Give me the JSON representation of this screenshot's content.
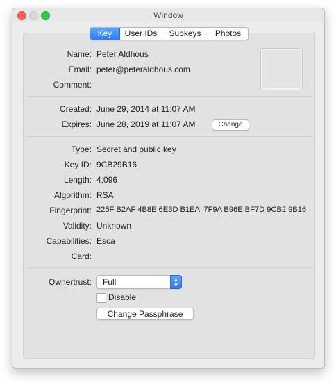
{
  "window": {
    "title": "Window"
  },
  "tabs": [
    {
      "label": "Key",
      "active": true
    },
    {
      "label": "User IDs",
      "active": false
    },
    {
      "label": "Subkeys",
      "active": false
    },
    {
      "label": "Photos",
      "active": false
    }
  ],
  "user": {
    "name_label": "Name:",
    "name": "Peter Aldhous",
    "email_label": "Email:",
    "email": "peter@peteraldhous.com",
    "comment_label": "Comment:",
    "comment": ""
  },
  "dates": {
    "created_label": "Created:",
    "created": "June 29, 2014 at 11:07 AM",
    "expires_label": "Expires:",
    "expires": "June 28, 2019 at 11:07 AM",
    "change_button": "Change"
  },
  "key": {
    "type_label": "Type:",
    "type": "Secret and public key",
    "keyid_label": "Key ID:",
    "keyid": "9CB29B16",
    "length_label": "Length:",
    "length": "4,096",
    "algorithm_label": "Algorithm:",
    "algorithm": "RSA",
    "fingerprint_label": "Fingerprint:",
    "fingerprint": "225F B2AF 4B8E 6E3D B1EA  7F9A B96E BF7D 9CB2 9B16",
    "validity_label": "Validity:",
    "validity": "Unknown",
    "capabilities_label": "Capabilities:",
    "capabilities": "Esca",
    "card_label": "Card:",
    "card": ""
  },
  "trust": {
    "ownertrust_label": "Ownertrust:",
    "ownertrust": "Full",
    "disable_label": "Disable",
    "change_passphrase_button": "Change Passphrase"
  },
  "colors": {
    "accent": "#2d7df6",
    "close": "#fc605b",
    "zoom": "#34c84a",
    "panel": "#e2e2e2"
  }
}
